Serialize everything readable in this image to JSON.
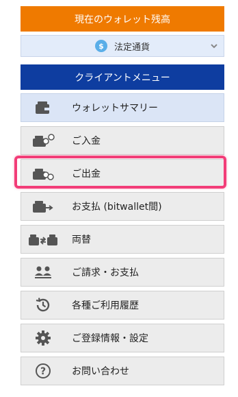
{
  "balance": {
    "header": "現在のウォレット残高"
  },
  "currency": {
    "selected": "法定通貨",
    "icon": "dollar-icon",
    "symbol": "$"
  },
  "menu": {
    "header": "クライアントメニュー",
    "items": [
      {
        "label": "ウォレットサマリー",
        "icon": "wallet-icon"
      },
      {
        "label": "ご入金",
        "icon": "wallet-deposit-icon"
      },
      {
        "label": "ご出金",
        "icon": "wallet-withdraw-icon"
      },
      {
        "label": "お支払 (bitwallet間)",
        "icon": "wallet-transfer-icon"
      },
      {
        "label": "両替",
        "icon": "exchange-icon"
      },
      {
        "label": "ご請求・お支払",
        "icon": "users-icon"
      },
      {
        "label": "各種ご利用履歴",
        "icon": "history-icon"
      },
      {
        "label": "ご登録情報・設定",
        "icon": "gear-icon"
      },
      {
        "label": "お問い合わせ",
        "icon": "question-icon"
      }
    ]
  },
  "colors": {
    "orange": "#ef7a00",
    "navy": "#0e3da0",
    "highlight": "#f23d78"
  }
}
